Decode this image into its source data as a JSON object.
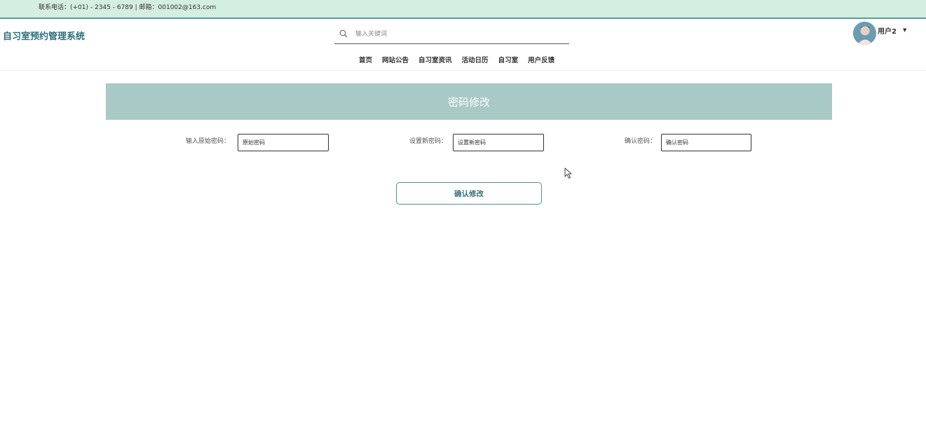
{
  "topbar": {
    "contact": "联系电话：(+01) - 2345 - 6789  |  邮箱：001002@163.com"
  },
  "header": {
    "site_title": "自习室预约管理系统",
    "search_placeholder": "输入关键词",
    "user_name": "用户2",
    "chevron": "▼"
  },
  "nav": {
    "items": [
      "首页",
      "网站公告",
      "自习室资讯",
      "活动日历",
      "自习室",
      "用户反馈"
    ]
  },
  "form": {
    "title": "密码修改",
    "old_password_label": "输入原始密码：",
    "old_password_placeholder": "原始密码",
    "new_password_label": "设置新密码：",
    "new_password_placeholder": "设置新密码",
    "confirm_label": "确认密码：",
    "confirm_placeholder": "确认密码",
    "submit_label": "确认修改"
  },
  "colors": {
    "topbar_bg": "#d4eee0",
    "accent": "#2f6f7a",
    "banner_bg": "#a9c9c6"
  }
}
